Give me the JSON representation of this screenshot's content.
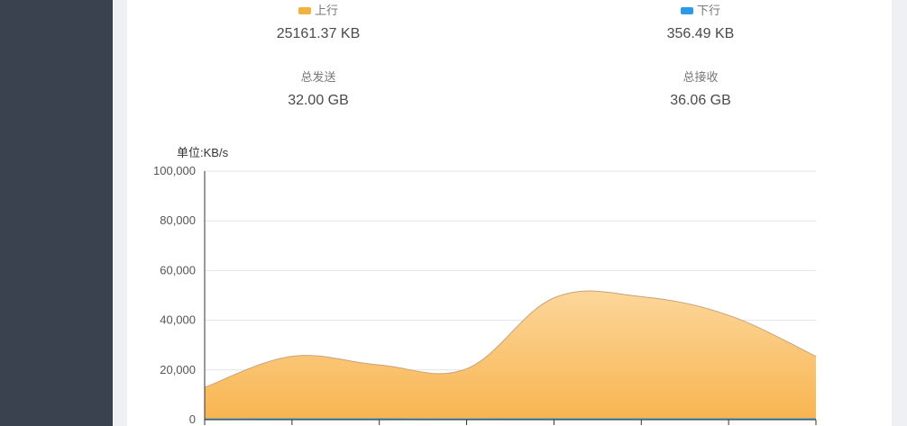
{
  "stats": {
    "upload": {
      "label": "上行",
      "value": "25161.37 KB",
      "color": "#f0b23c"
    },
    "download": {
      "label": "下行",
      "value": "356.49 KB",
      "color": "#2c9ae6"
    },
    "total_sent": {
      "label": "总发送",
      "value": "32.00 GB"
    },
    "total_received": {
      "label": "总接收",
      "value": "36.06 GB"
    }
  },
  "chart": {
    "unit_label": "单位:KB/s"
  },
  "chart_data": {
    "type": "area",
    "ylabel": "单位:KB/s",
    "ylim": [
      0,
      100000
    ],
    "y_ticks": [
      "0",
      "20,000",
      "40,000",
      "60,000",
      "80,000",
      "100,000"
    ],
    "grid": true,
    "series": [
      {
        "name": "上行",
        "color": "#f5b24e",
        "values": [
          13000,
          25500,
          22000,
          20500,
          49000,
          49500,
          42000,
          25500
        ]
      },
      {
        "name": "下行",
        "color": "#2c9ae6",
        "values": [
          300,
          360,
          340,
          330,
          380,
          370,
          360,
          356
        ]
      }
    ]
  }
}
